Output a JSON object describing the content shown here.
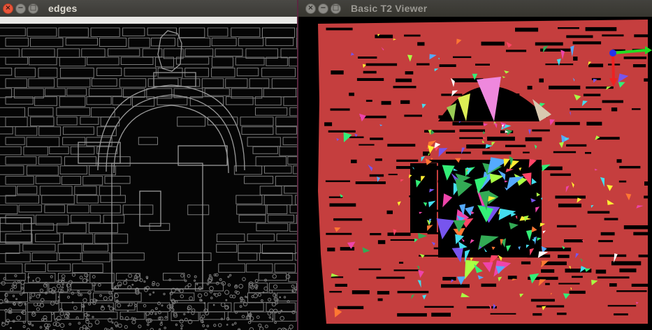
{
  "windows": {
    "edges": {
      "title": "edges",
      "buttons": {
        "close": "×",
        "minimize": "−",
        "maximize": "□"
      }
    },
    "t2_viewer": {
      "title": "Basic T2 Viewer",
      "buttons": {
        "close": "×",
        "minimize": "−",
        "maximize": "□"
      }
    }
  },
  "colors": {
    "mesh_fill": "#c53e3e",
    "axis_x": "#22dd22",
    "axis_y": "#ee2222",
    "axis_origin": "#2233ee",
    "edge_lines": "#8f8f8f"
  },
  "icons": [
    "close-icon",
    "minimize-icon",
    "maximize-icon",
    "axes-gizmo-icon"
  ]
}
